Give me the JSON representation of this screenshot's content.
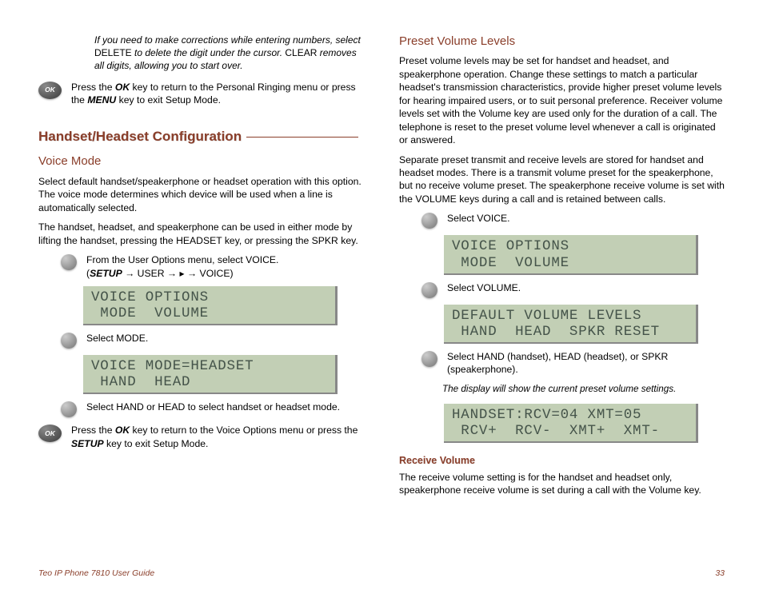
{
  "left": {
    "note_p1": "If you need to make corrections while entering numbers, select ",
    "note_del": "DELETE",
    "note_p2": " to delete the digit under the cursor. ",
    "note_clr": "CLEAR",
    "note_p3": " removes all digits, allowing you to start over.",
    "ok_label": "OK",
    "ok_step_a": "Press the ",
    "ok_step_b": "OK",
    "ok_step_c": " key to return to the Personal Ringing menu or press the ",
    "ok_step_d": "MENU",
    "ok_step_e": " key to exit Setup Mode.",
    "section": "Handset/Headset Configuration",
    "sub_voice": "Voice Mode",
    "vm_p1": "Select default handset/speakerphone or headset operation with this option. The voice mode determines which device will be used when a line is automatically selected.",
    "vm_p2a": "The handset, headset, and speakerphone can be used in either mode by lifting the handset, pressing the ",
    "vm_p2b": "HEADSET",
    "vm_p2c": " key, or pressing the ",
    "vm_p2d": "SPKR",
    "vm_p2e": " key.",
    "s1a": " From the User Options menu, select VOICE.",
    "s1b_a": "(",
    "s1b_b": "SETUP",
    "s1b_c": " → USER → ▸ → VOICE)",
    "lcd1": "VOICE OPTIONS\n MODE  VOLUME",
    "s2": "Select MODE.",
    "lcd2": "VOICE MODE=HEADSET\n HAND  HEAD",
    "s3": "Select HAND or HEAD to select handset or headset mode.",
    "s4a": "Press the ",
    "s4b": "OK",
    "s4c": " key to return to the Voice Options menu or press the ",
    "s4d": "SETUP",
    "s4e": " key to exit Setup Mode."
  },
  "right": {
    "sub_preset": "Preset Volume Levels",
    "p1a": "Preset volume levels may be set for handset and headset, and speakerphone operation. Change these settings to match a particular headset's transmission characteristics, provide higher preset volume levels for hearing impaired users, or to suit personal preference. Receiver volume levels set with the Volume key are used only for the duration of a call. The telephone is reset to the preset volume level whenever a call is originated or answered.",
    "p2a": "Separate preset transmit and receive levels are stored for handset and headset modes. There is a transmit volume preset for the speakerphone, but no receive volume preset. The speakerphone receive volume is set with the ",
    "p2b": "VOLUME",
    "p2c": " keys during a call and is retained between calls.",
    "s1": "Select VOICE.",
    "lcd1": "VOICE OPTIONS\n MODE  VOLUME",
    "s2": "Select VOLUME.",
    "lcd2": "DEFAULT VOLUME LEVELS\n HAND  HEAD  SPKR RESET",
    "s3": "Select HAND (handset), HEAD (headset), or SPKR (speakerphone).",
    "s3_ital": "The display will show the current preset volume settings.",
    "lcd3": "HANDSET:RCV=04 XMT=05\n RCV+  RCV-  XMT+  XMT-",
    "sub_recv": "Receive Volume",
    "recv_p": "The receive volume setting is for the handset and headset only, speakerphone receive volume is set during a call with the Volume key."
  },
  "footer": {
    "left": "Teo IP Phone 7810 User Guide",
    "right": "33"
  }
}
